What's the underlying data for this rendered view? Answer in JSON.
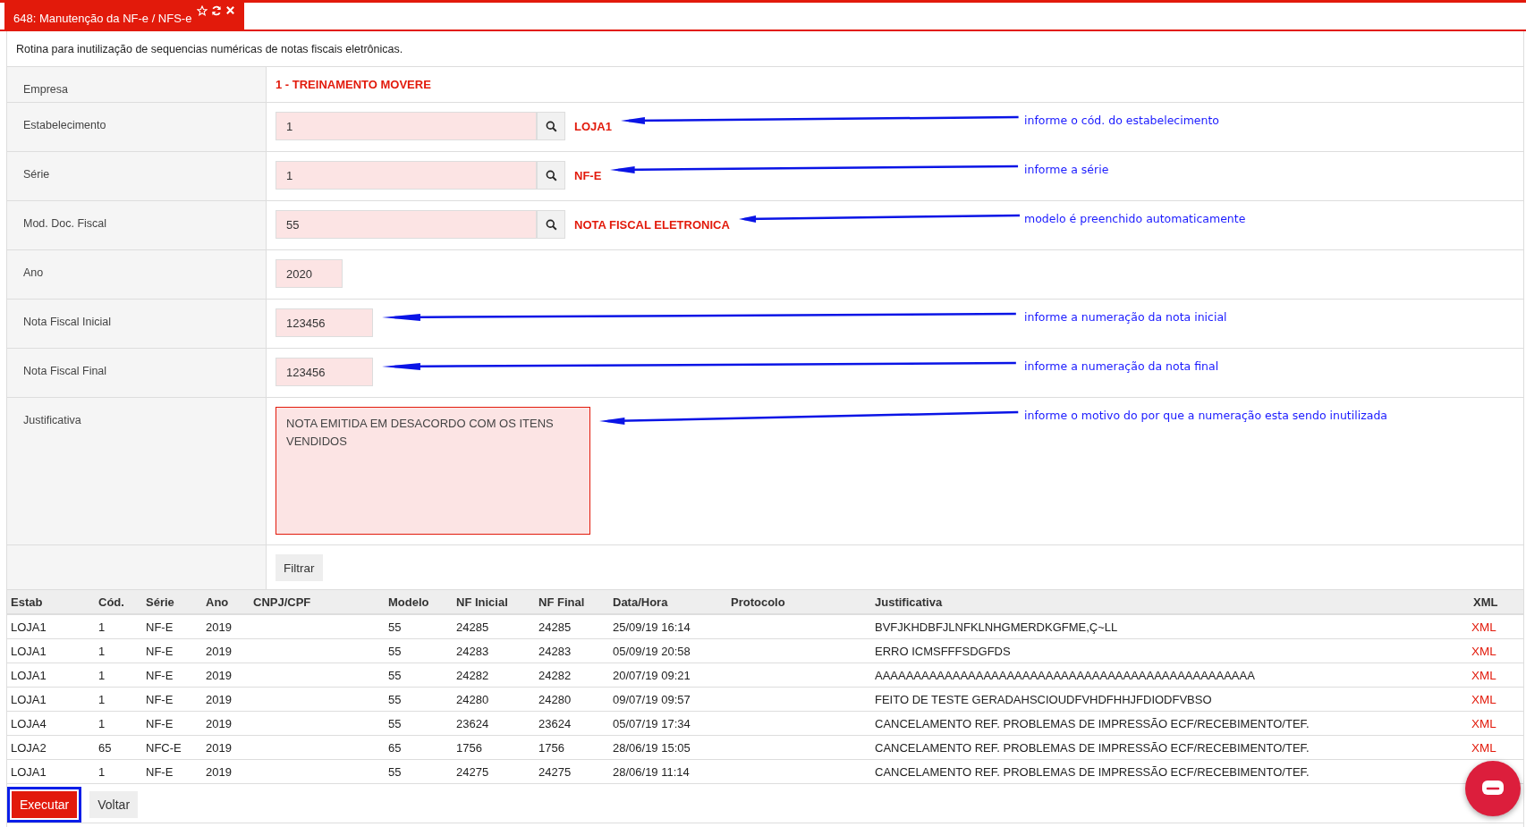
{
  "tab": {
    "title": "648: Manutenção da NF-e / NFS-e"
  },
  "description": "Rotina para inutilização de sequencias numéricas de notas fiscais eletrônicas.",
  "form_rows": [
    {
      "kind": "static",
      "label": "Empresa",
      "value": "1 - TREINAMENTO MOVERE"
    },
    {
      "kind": "lookup",
      "label": "Estabelecimento",
      "value": "1",
      "description": "LOJA1",
      "annotation": "informe o cód. do estabelecimento"
    },
    {
      "kind": "lookup",
      "label": "Série",
      "value": "1",
      "description": "NF-E",
      "annotation": "informe a série"
    },
    {
      "kind": "lookup",
      "label": "Mod. Doc. Fiscal",
      "value": "55",
      "description": "NOTA FISCAL ELETRONICA",
      "annotation": "modelo é preenchido automaticamente"
    },
    {
      "kind": "short",
      "label": "Ano",
      "value": "2020"
    },
    {
      "kind": "medium",
      "label": "Nota Fiscal Inicial",
      "value": "123456",
      "annotation": "informe a numeração da nota inicial"
    },
    {
      "kind": "medium",
      "label": "Nota Fiscal Final",
      "value": "123456",
      "annotation": "informe a numeração da nota final"
    },
    {
      "kind": "textarea",
      "label": "Justificativa",
      "value": "NOTA EMITIDA EM DESACORDO COM OS ITENS VENDIDOS",
      "annotation": "informe o motivo do por que a numeração esta sendo inutilizada"
    },
    {
      "kind": "button",
      "value": "Filtrar"
    }
  ],
  "table": {
    "columns": [
      "Estab",
      "Cód.",
      "Série",
      "Ano",
      "CNPJ/CPF",
      "Modelo",
      "NF Inicial",
      "NF Final",
      "Data/Hora",
      "Protocolo",
      "Justificativa",
      "XML"
    ],
    "rows": [
      [
        "LOJA1",
        "1",
        "NF-E",
        "2019",
        "",
        "55",
        "24285",
        "24285",
        "25/09/19 16:14",
        "",
        "BVFJKHDBFJLNFKLNHGMERDKGFME,Ç~LL",
        "XML"
      ],
      [
        "LOJA1",
        "1",
        "NF-E",
        "2019",
        "",
        "55",
        "24283",
        "24283",
        "05/09/19 20:58",
        "",
        "ERRO ICMSFFFSDGFDS",
        "XML"
      ],
      [
        "LOJA1",
        "1",
        "NF-E",
        "2019",
        "",
        "55",
        "24282",
        "24282",
        "20/07/19 09:21",
        "",
        "AAAAAAAAAAAAAAAAAAAAAAAAAAAAAAAAAAAAAAAAAAAAAAAAA",
        "XML"
      ],
      [
        "LOJA1",
        "1",
        "NF-E",
        "2019",
        "",
        "55",
        "24280",
        "24280",
        "09/07/19 09:57",
        "",
        "FEITO DE TESTE GERADAHSCIOUDFVHDFHHJFDIODFVBSO",
        "XML"
      ],
      [
        "LOJA4",
        "1",
        "NF-E",
        "2019",
        "",
        "55",
        "23624",
        "23624",
        "05/07/19 17:34",
        "",
        "CANCELAMENTO REF. PROBLEMAS DE IMPRESSÃO ECF/RECEBIMENTO/TEF.",
        "XML"
      ],
      [
        "LOJA2",
        "65",
        "NFC-E",
        "2019",
        "",
        "65",
        "1756",
        "1756",
        "28/06/19 15:05",
        "",
        "CANCELAMENTO REF. PROBLEMAS DE IMPRESSÃO ECF/RECEBIMENTO/TEF.",
        "XML"
      ],
      [
        "LOJA1",
        "1",
        "NF-E",
        "2019",
        "",
        "55",
        "24275",
        "24275",
        "28/06/19 11:14",
        "",
        "CANCELAMENTO REF. PROBLEMAS DE IMPRESSÃO ECF/RECEBIMENTO/TEF.",
        ""
      ]
    ]
  },
  "actions": [
    {
      "label": "Executar",
      "kind": "primary",
      "highlighted": true
    },
    {
      "label": "Voltar",
      "kind": "secondary",
      "highlighted": false
    }
  ]
}
